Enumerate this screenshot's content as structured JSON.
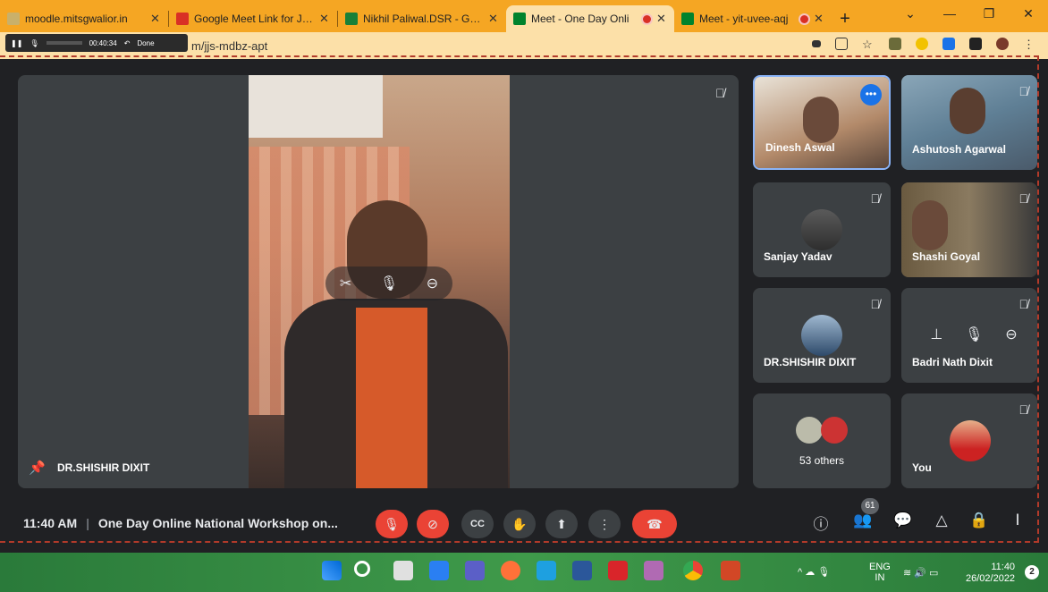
{
  "tabs": [
    {
      "title": "moodle.mitsgwalior.in",
      "fav": "#c9b06a",
      "rec": false
    },
    {
      "title": "Google Meet Link for Join",
      "fav": "#d93025",
      "rec": false
    },
    {
      "title": "Nikhil Paliwal.DSR - Goog",
      "fav": "#188038",
      "rec": false
    },
    {
      "title": "Meet - One Day Onli",
      "fav": "#00832d",
      "rec": true
    },
    {
      "title": "Meet - yit-uvee-aqj",
      "fav": "#00832d",
      "rec": true
    }
  ],
  "addressbar": {
    "url": "m/jjs-mdbz-apt",
    "rec_timer": "00:40:34",
    "rec_done": "Done"
  },
  "stage": {
    "name": "DR.SHISHIR DIXIT"
  },
  "tiles": [
    {
      "name": "Dinesh Aswal"
    },
    {
      "name": "Ashutosh Agarwal"
    },
    {
      "name": "Sanjay Yadav"
    },
    {
      "name": "Shashi Goyal"
    },
    {
      "name": "DR.SHISHIR DIXIT"
    },
    {
      "name": "Badri Nath Dixit"
    },
    {
      "name": "53 others"
    },
    {
      "name": "You"
    }
  ],
  "meeting": {
    "time": "11:40 AM",
    "title": "One Day Online National Workshop on...",
    "participants": "61"
  },
  "taskbar": {
    "lang1": "ENG",
    "lang2": "IN",
    "time": "11:40",
    "date": "26/02/2022",
    "notif": "2"
  },
  "colors": {
    "tabbar": "#f5a623",
    "end_call": "#ea4335",
    "tile_bg": "#3c4043"
  }
}
